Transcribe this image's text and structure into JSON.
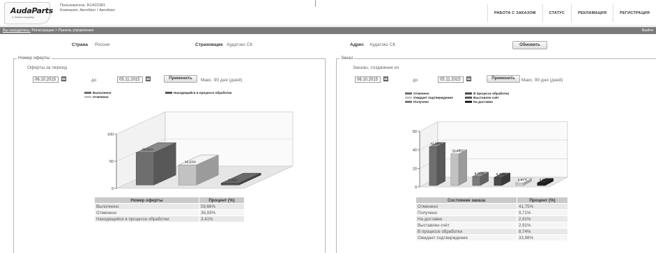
{
  "header": {
    "logo_title": "AudaParts",
    "logo_sub": "a Solera company",
    "user_line": "Пользователь: RU422381",
    "company_line": "Компания: АвтоКинг / АвтоКинг",
    "nav": [
      "РАБОТА С ЗАКАЗОМ",
      "СТАТУС",
      "РЕКЛАМАЦИЯ",
      "РЕГИСТРАЦИЯ"
    ]
  },
  "breadcrumb": {
    "prefix": "Вы находитесь:",
    "path": "Регистрация > Панель управления",
    "exit": "Выйти"
  },
  "info": {
    "country_label": "Страна",
    "country_value": "Россия",
    "insurer_label": "Страховщик",
    "insurer_value": "Аудатэкс СК",
    "address_label": "Адрес",
    "address_value": "Аудатэкс СК",
    "refresh_label": "Обновить"
  },
  "left_panel": {
    "legend": "Номер оферты",
    "subtitle": "Оферты,за период",
    "date_from": "06.10.2015",
    "to_label": "до",
    "date_to": "05.11.2015",
    "apply_label": "Применить",
    "max_note": "Макс. 90 дня (дней)",
    "legend_items": [
      {
        "label": "Выполнено",
        "color": "#6e6e6e"
      },
      {
        "label": "Отменено",
        "color": "#c2c2c2"
      },
      {
        "label": "Находящийся в процессе обработки",
        "color": "#555555"
      }
    ],
    "table_headers": [
      "Номер оферты",
      "Процент (%)"
    ],
    "table_rows": [
      [
        "Выполнено",
        "59,66%"
      ],
      [
        "Отменено",
        "36,93%"
      ],
      [
        "Находящийся в процессе обработки",
        "3,41%"
      ]
    ]
  },
  "right_panel": {
    "legend": "Заказ",
    "subtitle": "Заказы, созданные из",
    "date_from": "06.10.2015",
    "to_label": "до",
    "date_to": "05.11.2015",
    "apply_label": "Применить",
    "max_note": "Макс. 90 дня (дней)",
    "legend_items": [
      {
        "label": "Отменено",
        "color": "#6e6e6e"
      },
      {
        "label": "В процессе обработки",
        "color": "#4a4a4a"
      },
      {
        "label": "Ожидает подтверждение",
        "color": "#c2c2c2"
      },
      {
        "label": "Выставлен счёт",
        "color": "#555555"
      },
      {
        "label": "Получено",
        "color": "#7a7a7a"
      },
      {
        "label": "На доставке",
        "color": "#222222"
      }
    ],
    "table_headers": [
      "Состояние заказа",
      "Процент (%)"
    ],
    "table_rows": [
      [
        "Отменено",
        "41,75%"
      ],
      [
        "Получено",
        "9,71%"
      ],
      [
        "На доставке",
        "2,91%"
      ],
      [
        "Выставлен счёт",
        "2,91%"
      ],
      [
        "В процессе обработки",
        "8,74%"
      ],
      [
        "Ожидает подтверждение",
        "33,98%"
      ]
    ]
  },
  "chart_data": [
    {
      "type": "bar",
      "categories": [
        "Выполнено",
        "Отменено",
        "Находящийся в процессе обработки"
      ],
      "values": [
        59.66,
        36.93,
        3.41
      ],
      "labels": [
        "59,66%",
        "36,93%",
        "3,41%"
      ],
      "colors": [
        "#6e6e6e",
        "#c2c2c2",
        "#555555"
      ],
      "yticks": [
        "0",
        "50",
        "100"
      ],
      "ylim": [
        0,
        100
      ],
      "grid": true
    },
    {
      "type": "bar",
      "categories": [
        "Отменено",
        "Ожидает подтверждение",
        "Получено",
        "В процессе обработки",
        "Выставлен счёт",
        "На доставке"
      ],
      "values": [
        41.75,
        33.98,
        9.71,
        8.74,
        2.91,
        2.91
      ],
      "labels": [
        "41,75%",
        "33,98%",
        "9,71%",
        "8,74%",
        "2,91%",
        "2,91%"
      ],
      "colors": [
        "#6e6e6e",
        "#c2c2c2",
        "#7a7a7a",
        "#4a4a4a",
        "#cfcfcf",
        "#222222"
      ],
      "yticks": [
        "0",
        "20",
        "40",
        "60"
      ],
      "ylim": [
        0,
        60
      ],
      "grid": true
    }
  ]
}
